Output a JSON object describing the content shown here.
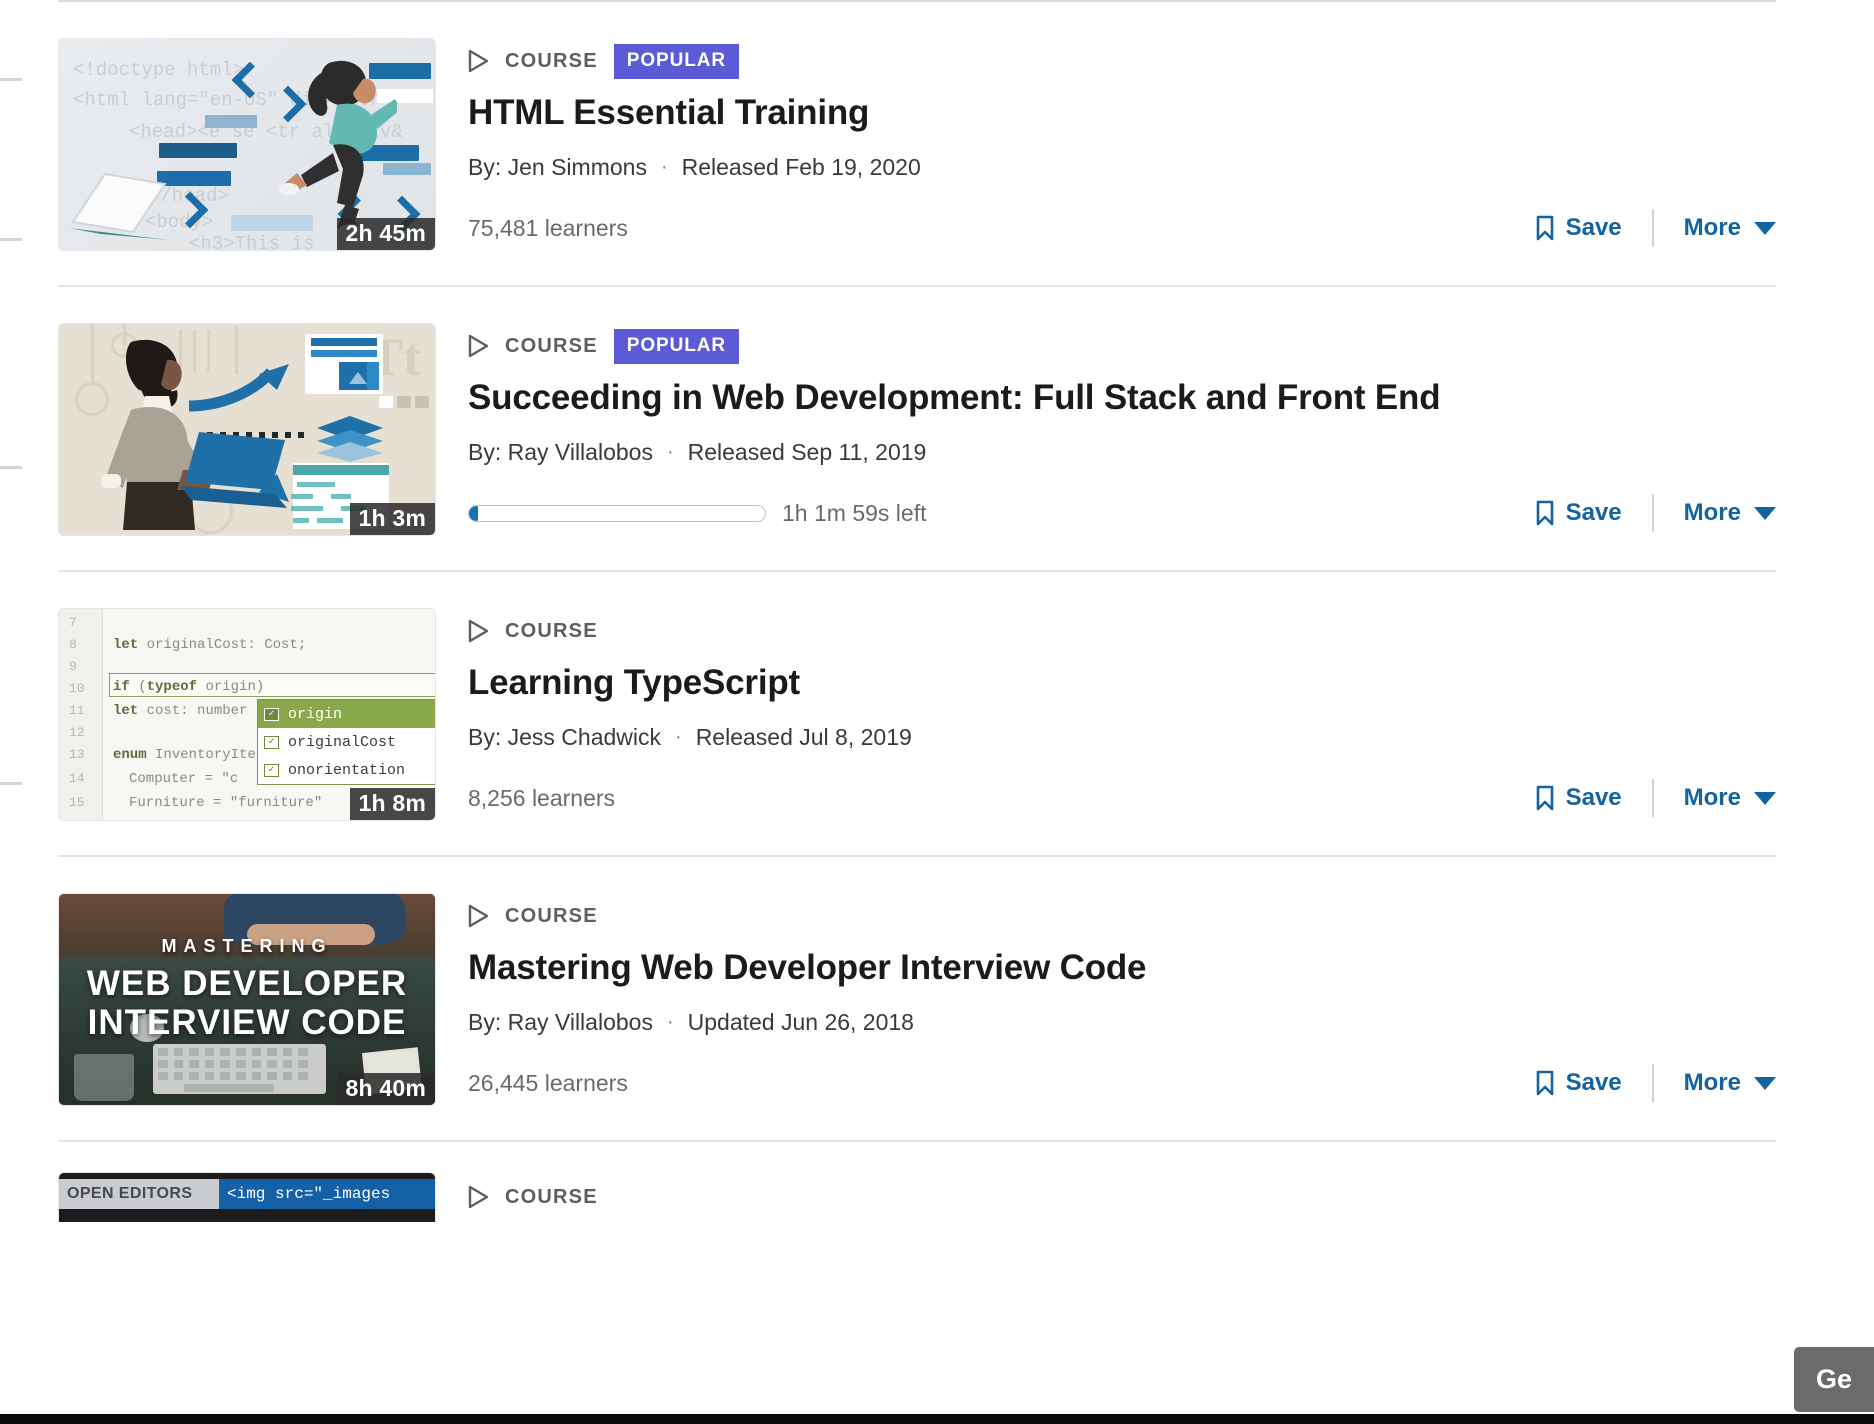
{
  "courses": [
    {
      "kind": "COURSE",
      "badge": "POPULAR",
      "title": "HTML Essential Training",
      "author": "By: Jen Simmons",
      "separator": "·",
      "release": "Released Feb 19, 2020",
      "duration": "2h 45m",
      "learners": "75,481 learners",
      "save_label": "Save",
      "more_label": "More",
      "thumb_alt": "Illustration of a woman leaping among HTML code snippets"
    },
    {
      "kind": "COURSE",
      "badge": "POPULAR",
      "title": "Succeeding in Web Development: Full Stack and Front End",
      "author": "By: Ray Villalobos",
      "separator": "·",
      "release": "Released Sep 11, 2019",
      "duration": "1h 3m",
      "progress_percent": 3,
      "time_left": "1h 1m 59s left",
      "save_label": "Save",
      "more_label": "More",
      "thumb_alt": "Illustration of a developer with a laptop and web layout diagrams"
    },
    {
      "kind": "COURSE",
      "badge": null,
      "title": "Learning TypeScript",
      "author": "By: Jess Chadwick",
      "separator": "·",
      "release": "Released Jul 8, 2019",
      "duration": "1h 8m",
      "learners": "8,256 learners",
      "save_label": "Save",
      "more_label": "More",
      "thumb_alt": "TypeScript code editor with autocomplete dropdown",
      "code_editor": {
        "line_numbers": [
          "7",
          "8",
          "9",
          "10",
          "11",
          "12",
          "13",
          "14",
          "15"
        ],
        "lines": [
          "let originalCost: Cost;",
          "if (typeof origin)",
          "let cost: number",
          "enum InventoryIte",
          "Computer = \"c",
          "Furniture = \"furniture\""
        ],
        "autocomplete": [
          "origin",
          "originalCost",
          "onorientation"
        ]
      }
    },
    {
      "kind": "COURSE",
      "badge": null,
      "title": "Mastering Web Developer Interview Code",
      "author": "By: Ray Villalobos",
      "separator": "·",
      "release": "Updated Jun 26, 2018",
      "duration": "8h 40m",
      "learners": "26,445 learners",
      "save_label": "Save",
      "more_label": "More",
      "thumb_alt": "Desk photo with keyboard and course title overlay",
      "thumb_text_top": "MASTERING",
      "thumb_text_main": "WEB DEVELOPER\nINTERVIEW CODE"
    }
  ],
  "partial_course": {
    "kind": "COURSE",
    "thumb_label_left": "OPEN EDITORS",
    "thumb_label_tab": "<img src=\"_images"
  },
  "floating_button": {
    "label": "Ge"
  },
  "colors": {
    "link": "#1263a0",
    "badge_popular": "#5b5bd6",
    "title": "#1b1b1b",
    "muted": "#6a6a6a",
    "kind": "#5e5e5e",
    "divider": "#e4e4e4",
    "progress_fill": "#1673b1",
    "duration_badge_bg": "#2a2a2a",
    "float_button_bg": "#6b6b6b"
  }
}
